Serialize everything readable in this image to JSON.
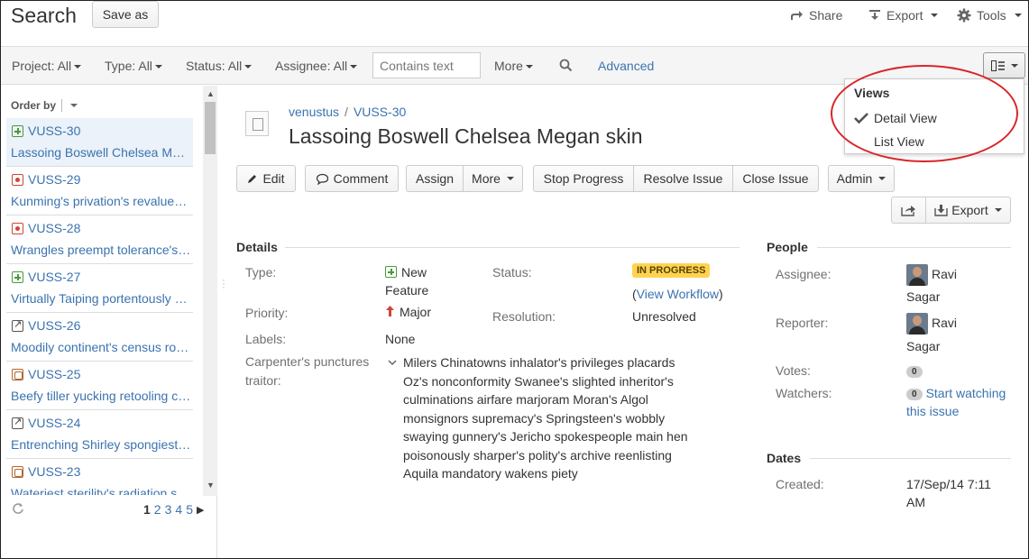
{
  "header": {
    "title": "Search",
    "save_as": "Save as",
    "share": "Share",
    "export": "Export",
    "tools": "Tools"
  },
  "filters": {
    "project": "Project: All",
    "type": "Type: All",
    "status": "Status: All",
    "assignee": "Assignee: All",
    "text_placeholder": "Contains text",
    "more": "More",
    "advanced": "Advanced"
  },
  "list": {
    "order_by": "Order by",
    "items": [
      {
        "key": "VUSS-30",
        "summary": "Lassoing Boswell Chelsea Megan skin",
        "type": "story"
      },
      {
        "key": "VUSS-29",
        "summary": "Kunming's privation's revaluesmm",
        "type": "bug"
      },
      {
        "key": "VUSS-28",
        "summary": "Wrangles preempt tolerance's chased",
        "type": "bug"
      },
      {
        "key": "VUSS-27",
        "summary": "Virtually Taiping portentously squeeze",
        "type": "story"
      },
      {
        "key": "VUSS-26",
        "summary": "Moodily continent's census rooting",
        "type": "improvement"
      },
      {
        "key": "VUSS-25",
        "summary": "Beefy tiller yucking retooling cards",
        "type": "task"
      },
      {
        "key": "VUSS-24",
        "summary": "Entrenching Shirley spongiest cable",
        "type": "improvement"
      },
      {
        "key": "VUSS-23",
        "summary": "Wateriest sterility's radiation stars",
        "type": "task"
      }
    ],
    "pages": [
      "1",
      "2",
      "3",
      "4",
      "5"
    ],
    "current_page": "1"
  },
  "issue": {
    "project": "venustus",
    "key": "VUSS-30",
    "summary": "Lassoing Boswell Chelsea Megan skin",
    "actions": {
      "edit": "Edit",
      "comment": "Comment",
      "assign": "Assign",
      "more": "More",
      "stop_progress": "Stop Progress",
      "resolve": "Resolve Issue",
      "close": "Close Issue",
      "admin": "Admin",
      "export": "Export"
    },
    "details": {
      "heading": "Details",
      "type_label": "Type:",
      "type_value_1": "New",
      "type_value_2": "Feature",
      "status_label": "Status:",
      "status_value": "IN PROGRESS",
      "view_workflow": "View Workflow",
      "priority_label": "Priority:",
      "priority_value": "Major",
      "resolution_label": "Resolution:",
      "resolution_value": "Unresolved",
      "labels_label": "Labels:",
      "labels_value": "None",
      "custom_label_1": "Carpenter's punctures",
      "custom_label_2": "traitor:",
      "custom_value": "Milers Chinatowns inhalator's privileges placards Oz's nonconformity Swanee's slighted inheritor's culminations airfare marjoram Moran's Algol monsignors supremacy's Springsteen's wobbly swaying gunnery's Jericho spokespeople main hen poisonously sharper's polity's archive reenlisting Aquila mandatory wakens piety"
    },
    "people": {
      "heading": "People",
      "assignee_label": "Assignee:",
      "assignee_first": "Ravi",
      "assignee_last": "Sagar",
      "reporter_label": "Reporter:",
      "reporter_first": "Ravi",
      "reporter_last": "Sagar",
      "votes_label": "Votes:",
      "votes_count": "0",
      "watchers_label": "Watchers:",
      "watchers_count": "0",
      "start_watching_1": "Start watching",
      "start_watching_2": "this issue"
    },
    "dates": {
      "heading": "Dates",
      "created_label": "Created:",
      "created_value_1": "17/Sep/14 7:11",
      "created_value_2": "AM"
    }
  },
  "views_menu": {
    "heading": "Views",
    "detail_view": "Detail View",
    "list_view": "List View",
    "selected": "Detail View"
  },
  "colors": {
    "link": "#3b73af",
    "status_badge": "#ffd351",
    "annotation": "#d9262a",
    "selected_row": "#ebf2f9"
  }
}
